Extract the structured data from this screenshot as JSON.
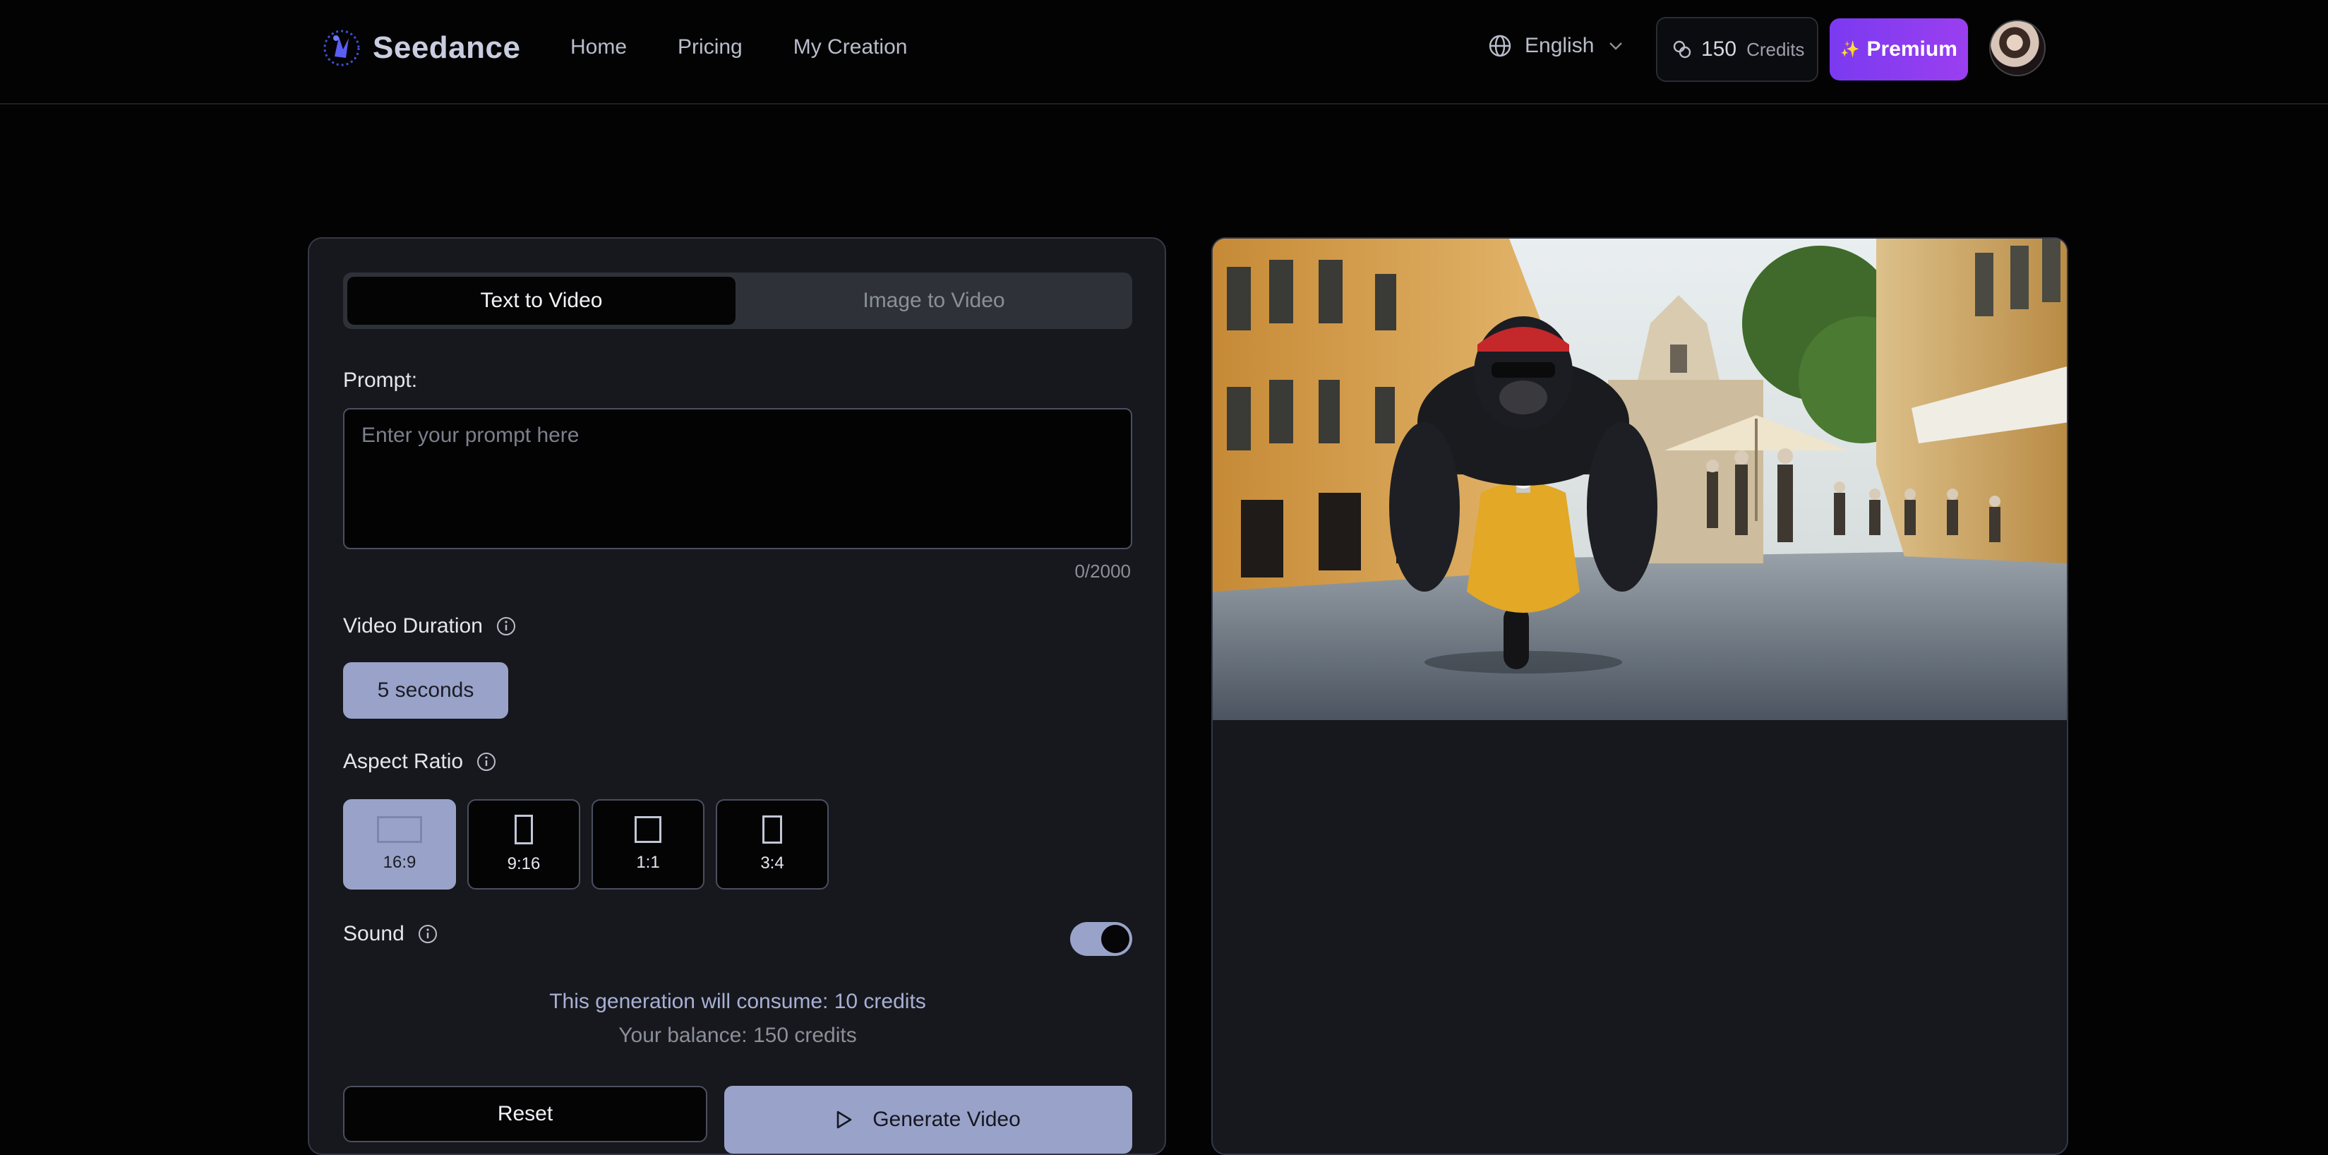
{
  "header": {
    "brand": "Seedance",
    "nav": [
      "Home",
      "Pricing",
      "My Creation"
    ],
    "language": "English",
    "credits_value": "150",
    "credits_label": "Credits",
    "premium_label": "Premium"
  },
  "generator": {
    "tabs": {
      "active": "Text to Video",
      "inactive": "Image to Video"
    },
    "prompt_label": "Prompt:",
    "prompt_placeholder": "Enter your prompt here",
    "prompt_counter": "0/2000",
    "duration_label": "Video Duration",
    "duration_value": "5 seconds",
    "aspect_label": "Aspect Ratio",
    "aspect_options": [
      "16:9",
      "9:16",
      "1:1",
      "3:4"
    ],
    "aspect_selected": "16:9",
    "sound_label": "Sound",
    "sound_on": true,
    "consume_text": "This generation will consume: 10 credits",
    "balance_text": "Your balance: 150 credits",
    "reset_label": "Reset",
    "generate_label": "Generate Video"
  },
  "colors": {
    "accent": "#99a3c9",
    "premium": "#8a3cf0",
    "background": "#030304",
    "panel": "#17181d"
  }
}
